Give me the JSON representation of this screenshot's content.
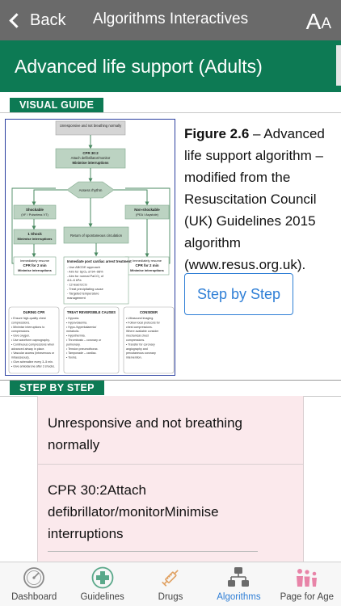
{
  "nav": {
    "back_label": "Back",
    "title": "Algorithms Interactives",
    "font_large": "A",
    "font_small": "A"
  },
  "page": {
    "title": "Advanced life support (Adults)"
  },
  "visual_guide": {
    "section_label": "VISUAL GUIDE",
    "figure_number": "Figure 2.6",
    "figure_caption": " – Advanced life support algorithm – modified from the Resuscitation Council (UK) Guidelines 2015 algorithm (www.resus.org.uk).",
    "step_button": "Step by Step",
    "diagram": {
      "top": "Unresponsive and not breathing normally",
      "cpr_line1": "CPR 30:2",
      "cpr_line2": "Attach defibrillator/monitor",
      "cpr_line3": "Minimise interruptions",
      "assess": "Assess rhythm",
      "shockable": "Shockable",
      "shockable_sub": "(VF / Pulseless VT)",
      "non_shockable": "Non-shockable",
      "non_shockable_sub": "(PEA / Asystole)",
      "shock": "1 Shock",
      "shock_sub": "Minimise interruptions",
      "rosc": "Return of spontaneous circulation",
      "resume_left1": "Immediately resume",
      "resume_left2": "CPR for 2 min",
      "resume_left3": "Minimise interruptions",
      "resume_right1": "Immediately resume",
      "resume_right2": "CPR for 2 min",
      "resume_right3": "Minimise interruptions",
      "post_title": "Immediate post cardiac arrest treatment",
      "post_items": [
        "- Use ABCDE approach",
        "- Aim for SpO₂ of 94–98%",
        "- Aim for normal PaCO₂ of",
        "  4.6–6 kPa",
        "- 12-lead ECG",
        "- Treat precipitating cause",
        "- Targeted temperature",
        "  management"
      ],
      "during_title": "DURING CPR",
      "during_items": [
        "• Ensure high-quality chest",
        "  compressions.",
        "• Minimise interruptions to",
        "  compressions.",
        "• Give oxygen.",
        "• Use waveform capnography.",
        "• Continuous compressions when",
        "  advanced airway in place.",
        "• Vascular access (intravenous or",
        "  intraosseous).",
        "• Give adrenaline every 3–5 min.",
        "• Give amiodarone after 3 shocks."
      ],
      "treat_title": "TREAT REVERSIBLE CAUSES",
      "treat_items": [
        "• Hypoxia.",
        "• Hypovolaemia.",
        "• Hypo-/hyperkalaemia/",
        "  metabolic.",
        "• Hypothermia.",
        "• Thrombosis – coronary or",
        "  pulmonary.",
        "• Tension pneumothorax.",
        "• Tamponade – cardiac.",
        "• Toxins."
      ],
      "consider_title": "CONSIDER",
      "consider_items": [
        "• Ultrasound imaging.",
        "• Follow local protocols for",
        "  chest compressions.",
        "  Where available consider",
        "  mechanical chest",
        "  compressions.",
        "• Transfer for coronary",
        "  angiography and",
        "  percutaneous coronary",
        "  intervention."
      ]
    }
  },
  "step_by_step": {
    "section_label": "STEP BY STEP",
    "steps": [
      "Unresponsive and not breathing normally",
      "CPR 30:2Attach defibrillator/monitorMinimise interruptions"
    ]
  },
  "tabbar": {
    "tabs": [
      {
        "label": "Dashboard",
        "icon": "dashboard-gauge-icon"
      },
      {
        "label": "Guidelines",
        "icon": "guidelines-cross-icon"
      },
      {
        "label": "Drugs",
        "icon": "syringe-icon"
      },
      {
        "label": "Algorithms",
        "icon": "algorithms-icon"
      },
      {
        "label": "Page for Age",
        "icon": "page-for-age-people-icon"
      }
    ],
    "active_tab": "Algorithms"
  },
  "colors": {
    "navbar": "#6a6a6a",
    "brand_green": "#0d7a54",
    "link_blue": "#2f7fd6",
    "step_bg": "#fbe9ec",
    "diagram_green": "#7ea88a"
  }
}
